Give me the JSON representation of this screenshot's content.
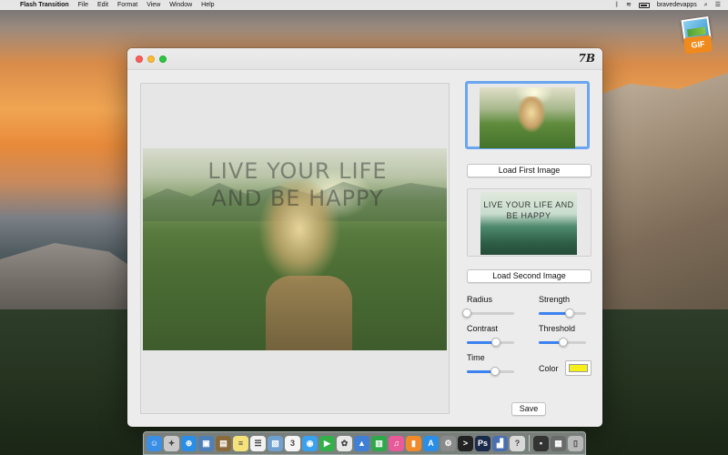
{
  "menubar": {
    "apple_glyph": "",
    "app_name": "Flash Transition",
    "items": [
      "File",
      "Edit",
      "Format",
      "View",
      "Window",
      "Help"
    ],
    "username": "bravedevapps"
  },
  "desktop_icon": {
    "badge": "GIF"
  },
  "window": {
    "logo_text": "7B",
    "preview_overlay_text": "LIVE YOUR LIFE AND BE HAPPY",
    "second_thumb_text": "LIVE YOUR LIFE AND BE HAPPY",
    "buttons": {
      "load_first": "Load First Image",
      "load_second": "Load Second Image",
      "save": "Save"
    },
    "controls": {
      "radius": {
        "label": "Radius",
        "value": 0.0
      },
      "strength": {
        "label": "Strength",
        "value": 0.65
      },
      "contrast": {
        "label": "Contrast",
        "value": 0.62
      },
      "threshold": {
        "label": "Threshold",
        "value": 0.52
      },
      "time": {
        "label": "Time",
        "value": 0.6
      },
      "color": {
        "label": "Color",
        "value": "#f6f01a"
      }
    }
  },
  "colors": {
    "accent": "#3b82f0",
    "selection_border": "#6aa6ef",
    "window_bg": "#ececec"
  },
  "dock": {
    "icons": [
      {
        "name": "finder-icon",
        "color": "#3a8ee6",
        "glyph": "☺"
      },
      {
        "name": "launchpad-icon",
        "color": "#c9c9c9",
        "glyph": "✦"
      },
      {
        "name": "safari-icon",
        "color": "#2a8de6",
        "glyph": "⊕"
      },
      {
        "name": "photo-icon",
        "color": "#4f7fb8",
        "glyph": "▣"
      },
      {
        "name": "notebook-icon",
        "color": "#8a6a3a",
        "glyph": "▤"
      },
      {
        "name": "notes-icon",
        "color": "#f5e27a",
        "glyph": "≡"
      },
      {
        "name": "reminders-icon",
        "color": "#f2f2f2",
        "glyph": "☰"
      },
      {
        "name": "preview-icon",
        "color": "#6fa0d0",
        "glyph": "▧"
      },
      {
        "name": "calendar-icon",
        "color": "#f5f5f5",
        "glyph": "3"
      },
      {
        "name": "messages-icon",
        "color": "#3aa0f0",
        "glyph": "◉"
      },
      {
        "name": "facetime-icon",
        "color": "#33b04a",
        "glyph": "▶"
      },
      {
        "name": "photos-icon",
        "color": "#e8e8e8",
        "glyph": "✿"
      },
      {
        "name": "keynote-icon",
        "color": "#3f7fd6",
        "glyph": "▲"
      },
      {
        "name": "numbers-icon",
        "color": "#2fa84a",
        "glyph": "▥"
      },
      {
        "name": "itunes-icon",
        "color": "#e85a9a",
        "glyph": "♫"
      },
      {
        "name": "ibooks-icon",
        "color": "#f08a2a",
        "glyph": "▮"
      },
      {
        "name": "app-store-icon",
        "color": "#2a8de6",
        "glyph": "A"
      },
      {
        "name": "system-prefs-icon",
        "color": "#8a8a8a",
        "glyph": "⚙"
      },
      {
        "name": "terminal-icon",
        "color": "#222222",
        "glyph": ">"
      },
      {
        "name": "photoshop-icon",
        "color": "#1a2a4a",
        "glyph": "Ps"
      },
      {
        "name": "chart-app-icon",
        "color": "#4a6fb0",
        "glyph": "▟"
      },
      {
        "name": "help-icon",
        "color": "#d9d9d9",
        "glyph": "?"
      },
      {
        "name": "console-icon",
        "color": "#333333",
        "glyph": "▪"
      },
      {
        "name": "downloads-icon",
        "color": "#6a6a6a",
        "glyph": "▦"
      },
      {
        "name": "trash-icon",
        "color": "#b8b8b8",
        "glyph": "▯"
      }
    ]
  }
}
